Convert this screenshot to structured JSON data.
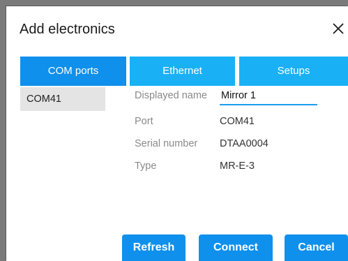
{
  "dialog": {
    "title": "Add electronics"
  },
  "tabs": [
    {
      "label": "COM ports",
      "active": true
    },
    {
      "label": "Ethernet",
      "active": false
    },
    {
      "label": "Setups",
      "active": false
    }
  ],
  "ports": [
    {
      "label": "COM41",
      "selected": true
    }
  ],
  "details": {
    "displayed_name_label": "Displayed name",
    "displayed_name_value": "Mirror 1",
    "port_label": "Port",
    "port_value": "COM41",
    "serial_label": "Serial number",
    "serial_value": "DTAA0004",
    "type_label": "Type",
    "type_value": "MR-E-3"
  },
  "buttons": {
    "refresh": "Refresh",
    "connect": "Connect",
    "cancel": "Cancel"
  },
  "colors": {
    "tab_active": "#0f90ec",
    "tab_inactive": "#1ab0f5",
    "button": "#0f90ec"
  }
}
